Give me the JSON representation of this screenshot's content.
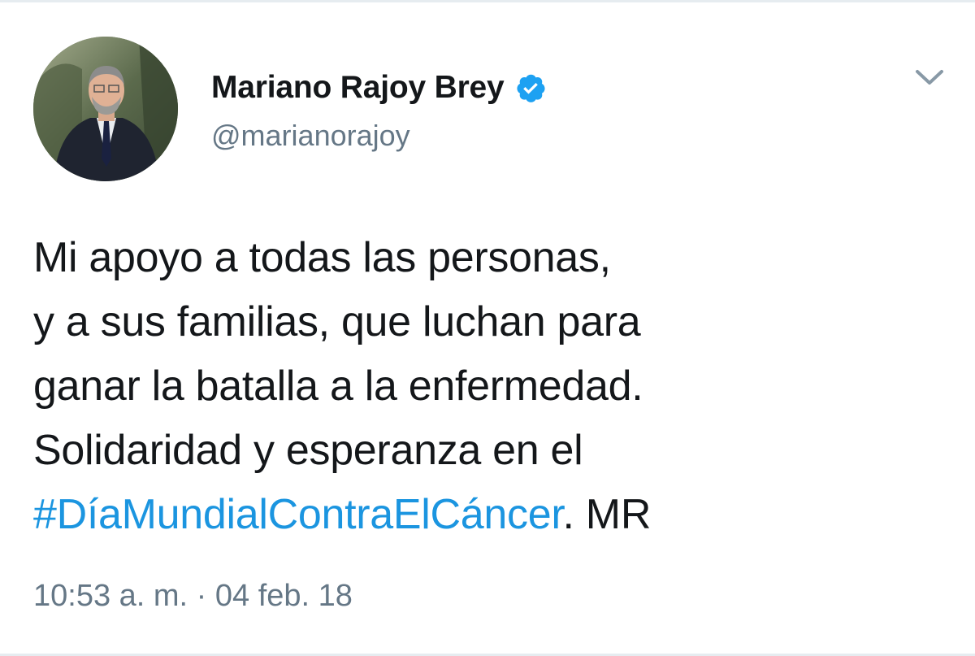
{
  "tweet": {
    "author": {
      "display_name": "Mariano Rajoy Brey",
      "handle": "@marianorajoy",
      "verified": true
    },
    "text_lines": [
      "Mi apoyo a todas las personas,",
      "y a sus familias, que luchan para",
      "ganar la batalla a la enfermedad.",
      "Solidaridad y esperanza en el"
    ],
    "hashtag": "#DíaMundialContraElCáncer",
    "signoff": ". MR",
    "timestamp": "10:53 a. m. · 04 feb. 18"
  },
  "icons": {
    "verified": "verified-badge-icon",
    "menu": "chevron-down-icon"
  },
  "colors": {
    "text": "#14171a",
    "secondary": "#657786",
    "link": "#1b95e0",
    "verified": "#1da1f2",
    "divider": "#e6ecf0"
  }
}
